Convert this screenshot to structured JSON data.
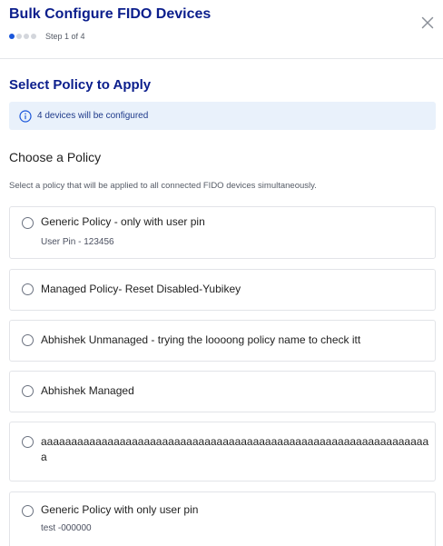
{
  "header": {
    "title": "Bulk Configure FIDO Devices",
    "step_text": "Step 1 of 4",
    "total_steps": 4,
    "current_step": 1,
    "close_icon": "close-icon"
  },
  "section": {
    "title": "Select Policy to Apply"
  },
  "info": {
    "icon": "info-icon",
    "text": "4 devices will be configured"
  },
  "choose": {
    "heading": "Choose a Policy",
    "description": "Select a policy that will be applied to all connected FIDO devices simultaneously."
  },
  "policies": [
    {
      "name": "Generic Policy - only with user pin",
      "detail": "User Pin - 123456"
    },
    {
      "name": "Managed Policy- Reset Disabled-Yubikey"
    },
    {
      "name": "Abhishek Unmanaged - trying the loooong policy name to check itt"
    },
    {
      "name": "Abhishek Managed"
    },
    {
      "name": "aaaaaaaaaaaaaaaaaaaaaaaaaaaaaaaaaaaaaaaaaaaaaaaaaaaaaaaaaaaaaaaaa"
    },
    {
      "name": "Generic Policy with only user pin",
      "detail": "test -000000"
    }
  ],
  "colors": {
    "title": "#0b1e8c",
    "accent": "#1a56db",
    "info_bg": "#e9f1fb"
  }
}
